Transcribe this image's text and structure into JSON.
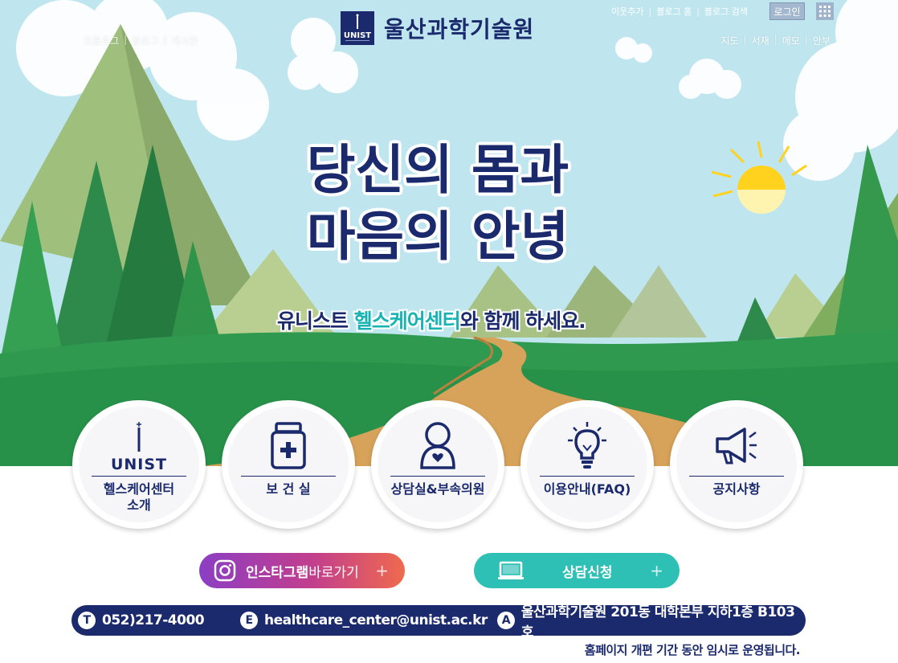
{
  "header": {
    "left_links": [
      "프롤로그",
      "블로그",
      "게시판"
    ],
    "right_links": [
      "지도",
      "서재",
      "메모",
      "안부"
    ],
    "util_links": [
      "이웃추가",
      "블로그 홈",
      "블로그 검색"
    ],
    "login_label": "로그인",
    "logo_wordmark": "UNIST",
    "logo_text": "울산과학기술원"
  },
  "hero": {
    "headline_line1": "당신의 몸과",
    "headline_line2": "마음의 안녕",
    "sub_before": "유니스트 ",
    "sub_accent": "헬스케어센터",
    "sub_after": "와 함께 하세요."
  },
  "menu": {
    "intro": "헬스케어센터\n소개",
    "clinic": "보 건 실",
    "counsel": "상담실&부속의원",
    "faq": "이용안내(FAQ)",
    "notice": "공지사항",
    "intro_logo": "UNIST"
  },
  "actions": {
    "insta_bold": "인스타그램",
    "insta_rest": " 바로가기",
    "counsel_label": "상담신청",
    "plus": "+"
  },
  "contact": {
    "tel_badge": "T",
    "tel": "052)217-4000",
    "email_badge": "E",
    "email": "healthcare_center@unist.ac.kr",
    "addr_badge": "A",
    "address": "울산과학기술원 201동 대학본부 지하1층 B103호"
  },
  "notice_text": "홈페이지 개편 기간 동안 임시로 운영됩니다.",
  "colors": {
    "navy": "#1a2a6c",
    "teal": "#19b3b3",
    "sky": "#bfe6ef",
    "grass": "#2f9a4f"
  }
}
